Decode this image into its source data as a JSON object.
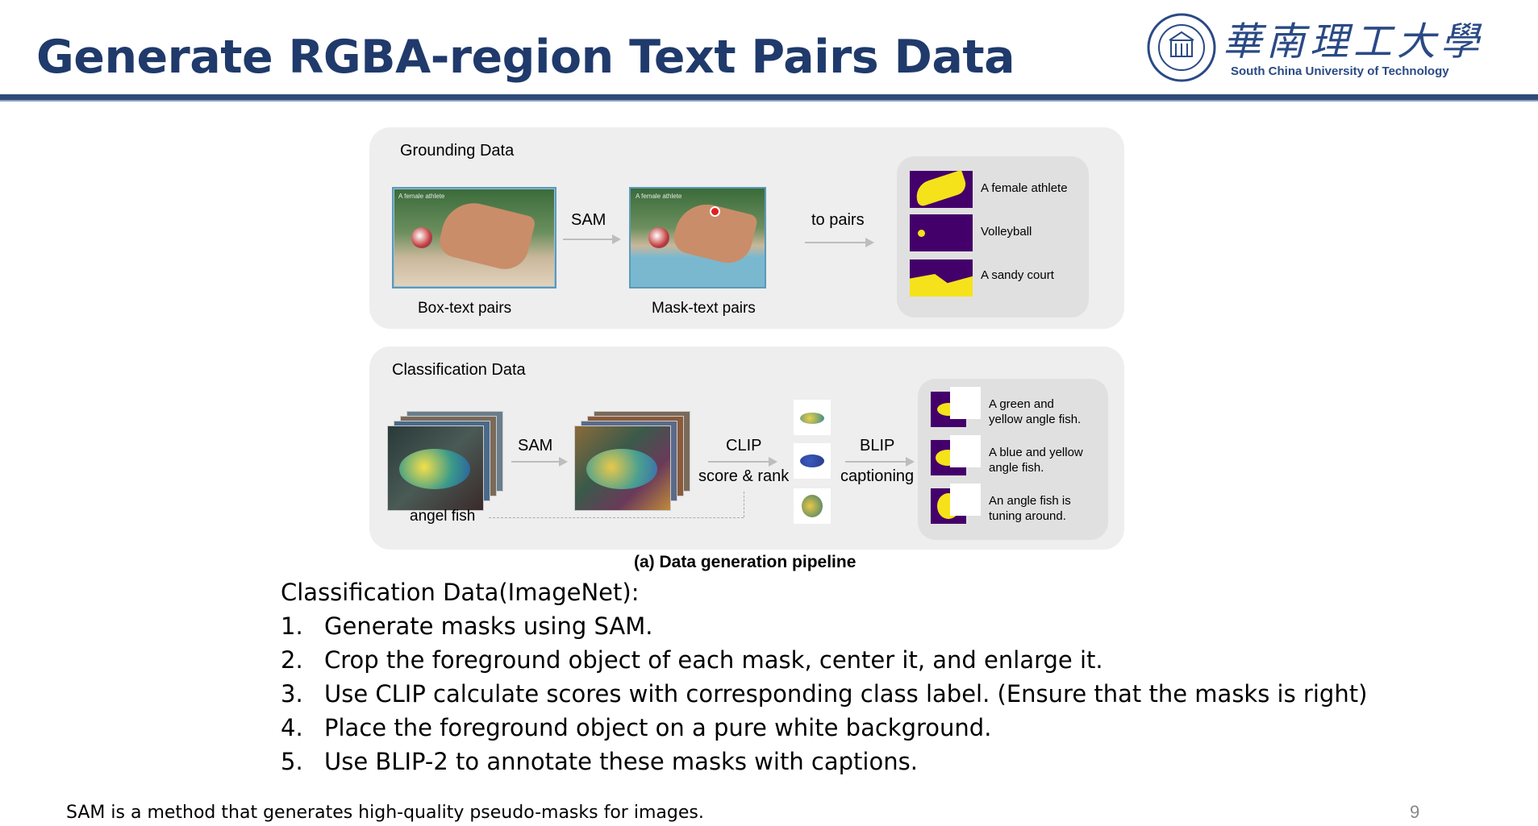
{
  "title": "Generate RGBA-region Text Pairs Data",
  "university": {
    "name_cn": "華南理工大學",
    "name_en": "South China University of Technology",
    "brand_color": "#2a4a85"
  },
  "figure": {
    "grounding": {
      "heading": "Grounding Data",
      "box_text_caption": "Box-text pairs",
      "mask_text_caption": "Mask-text pairs",
      "box_label": "A female athlete",
      "arrow_sam": "SAM",
      "arrow_to_pairs": "to pairs",
      "pairs": [
        "A female athlete",
        "Volleyball",
        "A sandy court"
      ]
    },
    "classification": {
      "heading": "Classification Data",
      "input_caption": "angel fish",
      "arrow_sam": "SAM",
      "arrow_clip_line1": "CLIP",
      "arrow_clip_line2": "score & rank",
      "arrow_blip_line1": "BLIP",
      "arrow_blip_line2": "captioning",
      "captions": [
        {
          "line1": "A green and",
          "line2": "yellow angle fish."
        },
        {
          "line1": "A blue and yellow",
          "line2": "angle fish."
        },
        {
          "line1": "An angle fish is",
          "line2": "tuning around."
        }
      ]
    },
    "caption": "(a) Data generation pipeline"
  },
  "list": {
    "intro": "Classification Data(ImageNet):",
    "items": [
      {
        "num": "1.",
        "text": "Generate masks using SAM."
      },
      {
        "num": "2.",
        "text": "Crop the foreground object of each mask, center it, and enlarge it."
      },
      {
        "num": "3.",
        "text": "Use CLIP calculate scores with corresponding class label. (Ensure that the masks is right)"
      },
      {
        "num": "4.",
        "text": "Place the foreground object on a pure white background."
      },
      {
        "num": "5.",
        "text": "Use BLIP-2 to annotate these masks with captions."
      }
    ]
  },
  "footnote": "SAM is a method that generates high-quality pseudo-masks for images.",
  "page_number": "9"
}
